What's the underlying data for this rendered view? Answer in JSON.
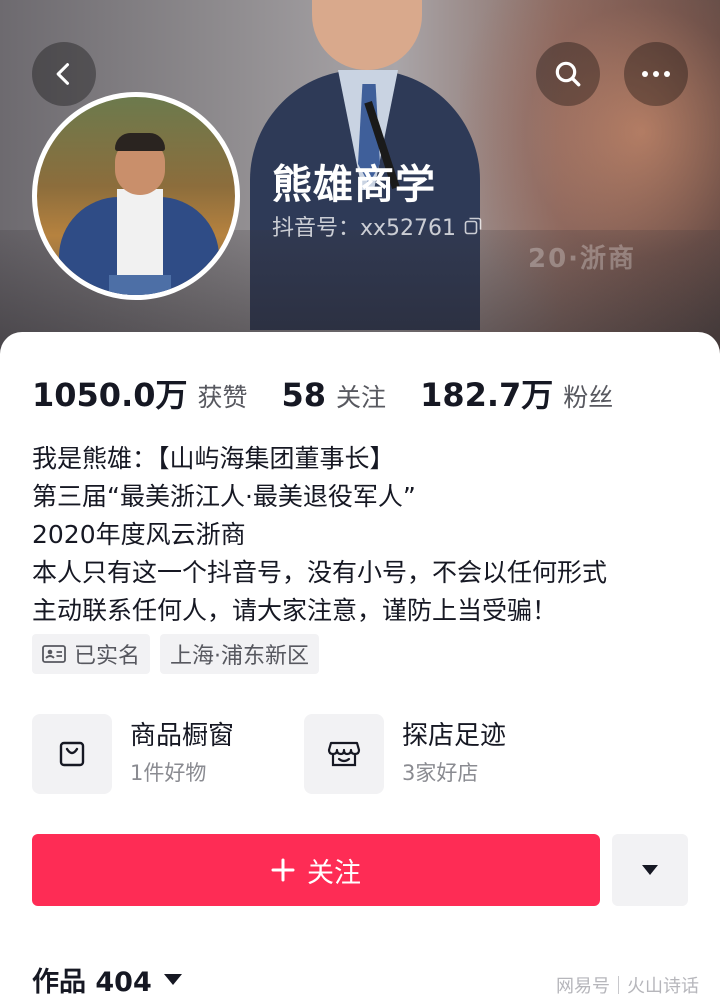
{
  "header": {
    "back_icon": "chevron-left-icon",
    "search_icon": "search-icon",
    "more_icon": "more-horizontal-icon",
    "cover_brand_text": "20·浙商"
  },
  "profile": {
    "name": "熊雄商学",
    "douyin_id_label": "抖音号：xx52761",
    "copy_icon": "copy-icon"
  },
  "stats": [
    {
      "value": "1050.0万",
      "label": "获赞"
    },
    {
      "value": "58",
      "label": "关注"
    },
    {
      "value": "182.7万",
      "label": "粉丝"
    }
  ],
  "bio": {
    "lines": [
      "我是熊雄：【山屿海集团董事长】",
      "第三届“最美浙江人·最美退役军人”",
      "2020年度风云浙商",
      "本人只有这一个抖音号，没有小号，不会以任何形式",
      "主动联系任何人，请大家注意，谨防上当受骗！"
    ]
  },
  "tags": [
    {
      "label": "已实名",
      "icon": "id-card-icon"
    },
    {
      "label": "上海·浦东新区"
    }
  ],
  "features": [
    {
      "title": "商品橱窗",
      "subtitle": "1件好物",
      "icon": "shopping-bag-icon"
    },
    {
      "title": "探店足迹",
      "subtitle": "3家好店",
      "icon": "storefront-icon"
    }
  ],
  "actions": {
    "follow_label": "关注",
    "follow_icon": "plus-icon",
    "dropdown_icon": "triangle-down-icon",
    "accent_color": "#fe2c55"
  },
  "works": {
    "label": "作品 404"
  },
  "watermark": {
    "left": "网易号",
    "right": "火山诗话"
  }
}
